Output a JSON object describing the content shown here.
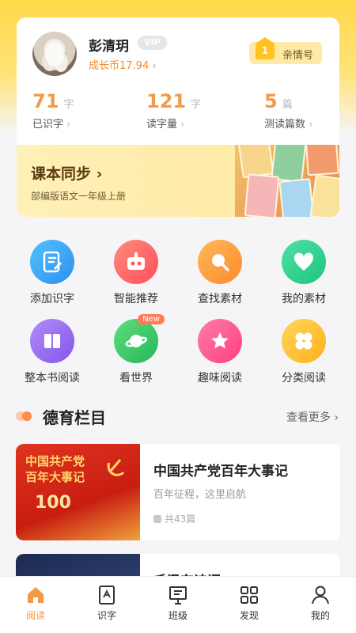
{
  "profile": {
    "name": "彭清玥",
    "vip": "VIP",
    "coins": "成长币17.94 ›",
    "family_badge_num": "1",
    "family_label": "亲情号"
  },
  "stats": [
    {
      "value": "71",
      "unit": "字",
      "caption": "已识字"
    },
    {
      "value": "121",
      "unit": "字",
      "caption": "读字量"
    },
    {
      "value": "5",
      "unit": "篇",
      "caption": "测读篇数"
    }
  ],
  "course": {
    "title": "课本同步 ›",
    "subtitle": "部编版语文一年级上册"
  },
  "features": [
    {
      "label": "添加识字",
      "icon": "notebook-pen-icon",
      "color": "#3ca6f5"
    },
    {
      "label": "智能推荐",
      "icon": "robot-icon",
      "color": "#ff6b6b"
    },
    {
      "label": "查找素材",
      "icon": "search-icon",
      "color": "#ff9a3c"
    },
    {
      "label": "我的素材",
      "icon": "heart-icon",
      "color": "#2fd38f"
    },
    {
      "label": "整本书阅读",
      "icon": "open-book-icon",
      "color": "#9b6bf2"
    },
    {
      "label": "看世界",
      "icon": "planet-icon",
      "color": "#36c96a",
      "badge": "New"
    },
    {
      "label": "趣味阅读",
      "icon": "star-icon",
      "color": "#ff5a8e"
    },
    {
      "label": "分类阅读",
      "icon": "clover-icon",
      "color": "#ffc21f"
    }
  ],
  "section": {
    "title": "德育栏目",
    "more": "查看更多"
  },
  "articles": [
    {
      "title": "中国共产党百年大事记",
      "subtitle": "百年征程，这里启航",
      "count": "共43篇",
      "thumb_line1": "中国共产党",
      "thumb_line2": "百年大事记",
      "thumb_num": "100"
    },
    {
      "title": "毛泽东诗词",
      "subtitle": "",
      "count": ""
    }
  ],
  "tabs": [
    {
      "label": "阅读",
      "icon": "home-icon",
      "active": true
    },
    {
      "label": "识字",
      "icon": "book-icon",
      "active": false
    },
    {
      "label": "班级",
      "icon": "board-icon",
      "active": false
    },
    {
      "label": "发现",
      "icon": "grid-icon",
      "active": false
    },
    {
      "label": "我的",
      "icon": "user-icon",
      "active": false
    }
  ],
  "colors": {
    "accent": "#f39a4a",
    "header_yellow": "#ffd84a"
  }
}
